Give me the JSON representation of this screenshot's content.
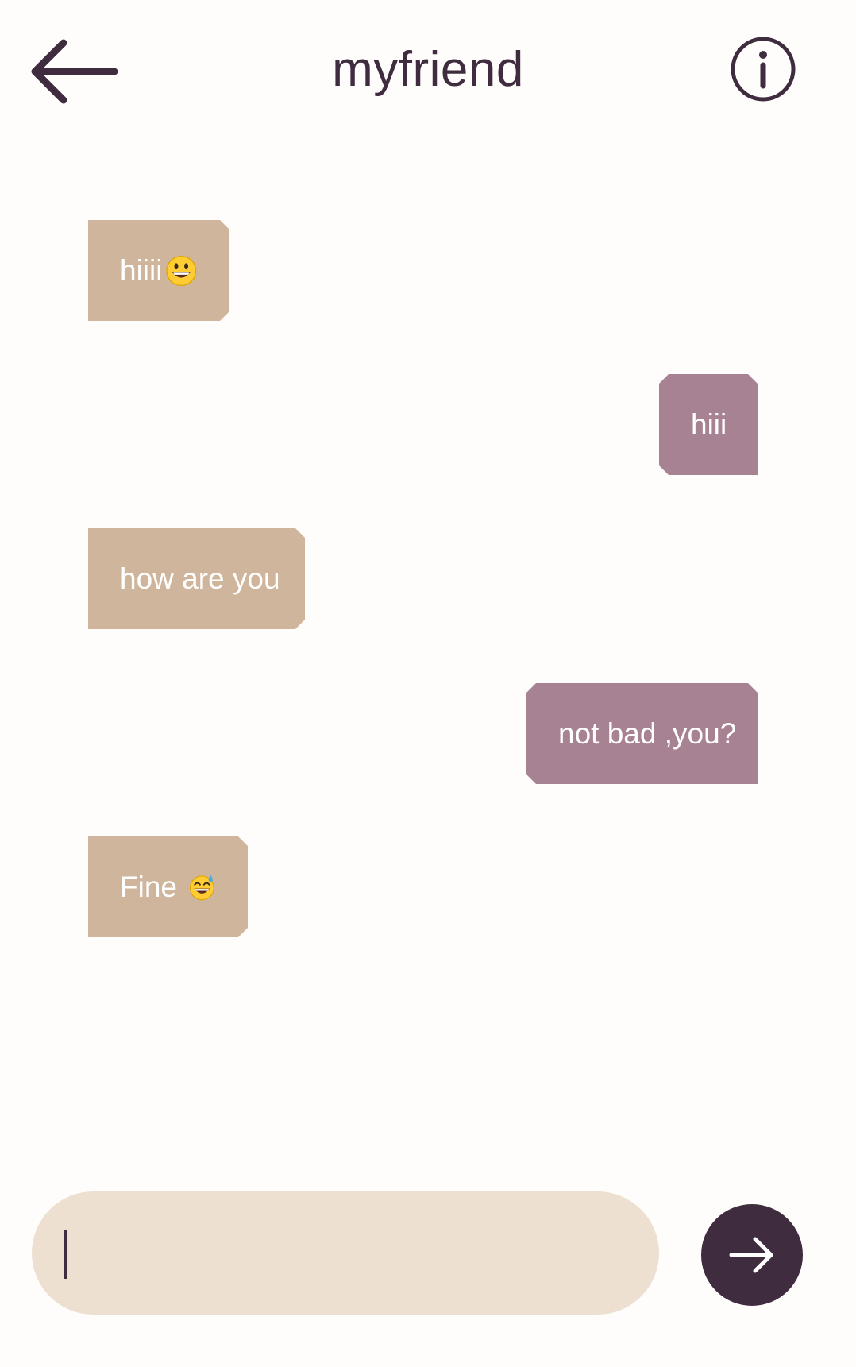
{
  "header": {
    "title": "myfriend",
    "back_icon": "arrow-left-icon",
    "info_icon": "info-circle-icon"
  },
  "messages": [
    {
      "from": "friend",
      "text": "hiiii",
      "emoji": "grinning-face-emoji"
    },
    {
      "from": "me",
      "text": "hiii"
    },
    {
      "from": "friend",
      "text": "how are you"
    },
    {
      "from": "me",
      "text": "not bad ,you?"
    },
    {
      "from": "friend",
      "text": "Fine ",
      "emoji": "grinning-face-with-sweat-emoji"
    }
  ],
  "composer": {
    "value": "",
    "send_icon": "arrow-right-icon"
  },
  "colors": {
    "title": "#3f2c3e",
    "received_bubble": "#cfb59c",
    "sent_bubble": "#a78292",
    "input_background": "#ede0d1",
    "send_button": "#3f2c3e",
    "background": "#fffdfc"
  }
}
